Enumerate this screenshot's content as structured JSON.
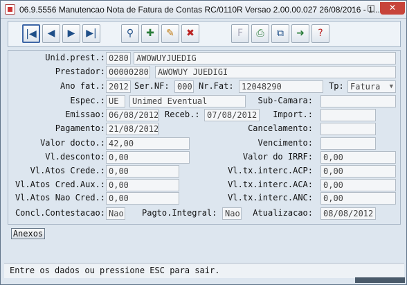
{
  "window": {
    "title": "06.9.5556 Manutencao  Nota de Fatura de Contas RC/0110R Versao 2.00.00.027 26/08/2016 - 1..."
  },
  "form": {
    "unid_prest": {
      "label": "Unid.prest.:",
      "code": "0280",
      "name": "AWOWUYJUEDIG"
    },
    "prestador": {
      "label": "Prestador:",
      "code": "00000280",
      "name": "AWOWUY JUEDIGI"
    },
    "ano_fat": {
      "label": "Ano fat.:",
      "value": "2012"
    },
    "ser_nf": {
      "label": "Ser.NF:",
      "value": "000"
    },
    "nr_fat": {
      "label": "Nr.Fat:",
      "value": "12048290"
    },
    "tp": {
      "label": "Tp:",
      "value": "Fatura"
    },
    "espec": {
      "label": "Espec.:",
      "code": "UE",
      "name": "Unimed Eventual"
    },
    "sub_camara": {
      "label": "Sub-Camara:",
      "value": ""
    },
    "emissao": {
      "label": "Emissao:",
      "value": "06/08/2012"
    },
    "receb": {
      "label": "Receb.:",
      "value": "07/08/2012"
    },
    "import": {
      "label": "Import.:",
      "value": ""
    },
    "pagamento": {
      "label": "Pagamento:",
      "value": "21/08/2012"
    },
    "cancelamento": {
      "label": "Cancelamento:",
      "value": ""
    },
    "valor_docto": {
      "label": "Valor docto.:",
      "value": "42,00"
    },
    "vencimento": {
      "label": "Vencimento:",
      "value": ""
    },
    "vl_desconto": {
      "label": "Vl.desconto:",
      "value": "0,00"
    },
    "valor_irrf": {
      "label": "Valor do IRRF:",
      "value": "0,00"
    },
    "vl_atos_crede": {
      "label": "Vl.Atos Crede.:",
      "value": "0,00"
    },
    "vl_tx_acp": {
      "label": "Vl.tx.interc.ACP:",
      "value": "0,00"
    },
    "vl_atos_cred_aux": {
      "label": "Vl.Atos Cred.Aux.:",
      "value": "0,00"
    },
    "vl_tx_aca": {
      "label": "Vl.tx.interc.ACA:",
      "value": "0,00"
    },
    "vl_atos_nao_cred": {
      "label": "Vl.Atos Nao Cred.:",
      "value": "0,00"
    },
    "vl_tx_anc": {
      "label": "Vl.tx.interc.ANC:",
      "value": "0,00"
    },
    "concl_contestacao": {
      "label": "Concl.Contestacao:",
      "value": "Nao"
    },
    "pagto_integral": {
      "label": "Pagto.Integral:",
      "value": "Nao"
    },
    "atualizacao": {
      "label": "Atualizacao:",
      "value": "08/08/2012"
    }
  },
  "buttons": {
    "anexos": "Anexos"
  },
  "status": {
    "message": "Entre os dados ou pressione ESC para sair."
  }
}
